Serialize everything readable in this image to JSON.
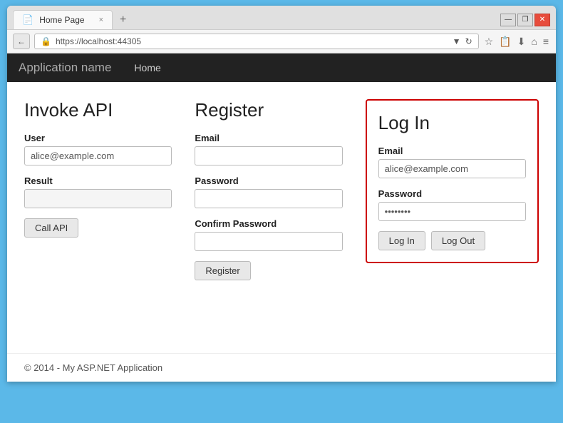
{
  "browser": {
    "tab_title": "Home Page",
    "tab_icon": "📄",
    "tab_close": "×",
    "tab_new": "+",
    "url": "https://localhost:44305",
    "win_minimize": "—",
    "win_restore": "❐",
    "win_close": "✕",
    "back_arrow": "←",
    "lock_icon": "🔒",
    "refresh_icon": "↻",
    "star_icon": "☆",
    "clipboard_icon": "📋",
    "download_icon": "⬇",
    "home_icon": "⌂",
    "settings_icon": "≡",
    "dropdown_arrow": "▼"
  },
  "navbar": {
    "app_name": "Application name",
    "links": [
      {
        "label": "Home"
      }
    ]
  },
  "invoke_api": {
    "title": "Invoke API",
    "user_label": "User",
    "user_value": "alice@example.com",
    "result_label": "Result",
    "result_value": "",
    "button_label": "Call API"
  },
  "register": {
    "title": "Register",
    "email_label": "Email",
    "email_value": "",
    "password_label": "Password",
    "password_value": "",
    "confirm_label": "Confirm Password",
    "confirm_value": "",
    "button_label": "Register"
  },
  "login": {
    "title": "Log In",
    "email_label": "Email",
    "email_value": "alice@example.com",
    "password_label": "Password",
    "password_value": "••••••••",
    "login_button": "Log In",
    "logout_button": "Log Out"
  },
  "footer": {
    "text": "© 2014 - My ASP.NET Application"
  }
}
